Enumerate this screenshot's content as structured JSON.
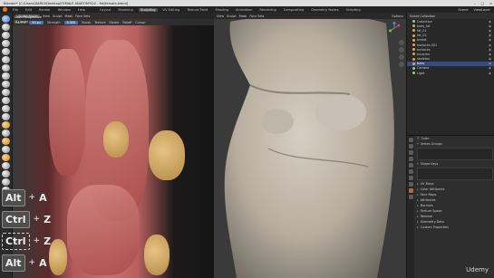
{
  "titlebar": {
    "text": "Blender* [C:\\Users\\DARIO\\Desktop\\FEMALE ANATOMY\\02 - Fat\\female.blend]",
    "buttons": [
      "–",
      "□",
      "×"
    ]
  },
  "menubar": {
    "menus": [
      "File",
      "Edit",
      "Render",
      "Window",
      "Help"
    ],
    "workspaces": [
      "Layout",
      "Modeling",
      "Sculpting",
      "UV Editing",
      "Texture Paint",
      "Shading",
      "Animation",
      "Rendering",
      "Compositing",
      "Geometry Nodes",
      "Scripting"
    ],
    "active_workspace": "Sculpting",
    "scene": "Scene",
    "view_layer": "ViewLayer"
  },
  "left_viewport": {
    "mode": "Sculpt Mode",
    "menus": [
      "View",
      "Sculpt",
      "Mask",
      "Face Sets"
    ],
    "brush_settings": [
      "Radius",
      "Strength",
      "Brush",
      "Texture",
      "Stroke",
      "Falloff",
      "Cursor"
    ],
    "radius_value": "50 px",
    "strength_value": "0.500",
    "overlay_line1": "User Perspective",
    "overlay_line2": "(1) body"
  },
  "shortcuts": [
    {
      "mod": "Alt",
      "key": "A",
      "outlined": false
    },
    {
      "mod": "Ctrl",
      "key": "Z",
      "outlined": false
    },
    {
      "mod": "Ctrl",
      "key": "Z",
      "outlined": true
    },
    {
      "mod": "Alt",
      "key": "A",
      "outlined": false
    }
  ],
  "right_viewport": {
    "menus": [
      "View",
      "Sculpt",
      "Mask",
      "Face Sets"
    ],
    "right_controls": [
      "Options"
    ]
  },
  "outliner": {
    "title": "Scene Collection",
    "items": [
      {
        "label": "Collection",
        "color": "g",
        "selected": false
      },
      {
        "label": "body_fat",
        "color": "o",
        "selected": false
      },
      {
        "label": "fat_01",
        "color": "o",
        "selected": false
      },
      {
        "label": "fat_02",
        "color": "o",
        "selected": false
      },
      {
        "label": "breast",
        "color": "o",
        "selected": false
      },
      {
        "label": "buttocks.001",
        "color": "o",
        "selected": false
      },
      {
        "label": "buttocks",
        "color": "o",
        "selected": false
      },
      {
        "label": "muscles",
        "color": "o",
        "selected": false
      },
      {
        "label": "skeleton",
        "color": "o",
        "selected": false
      },
      {
        "label": "body",
        "color": "o",
        "selected": true
      },
      {
        "label": "Camera",
        "color": "g",
        "selected": false
      },
      {
        "label": "Light",
        "color": "g",
        "selected": false
      }
    ]
  },
  "properties": {
    "object_name": "Cube",
    "sections": [
      "Vertex Groups",
      "Shape Keys",
      "UV Maps",
      "Color Attributes",
      "Face Maps",
      "Attributes",
      "Normals",
      "Texture Space",
      "Remesh",
      "Geometry Data",
      "Custom Properties"
    ]
  },
  "watermark": "Udemy"
}
